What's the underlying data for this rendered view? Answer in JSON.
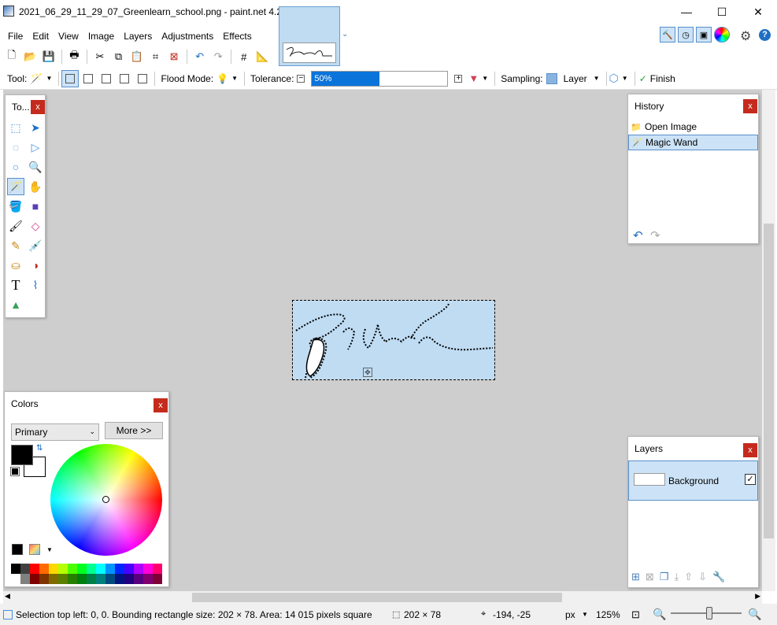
{
  "window": {
    "title": "2021_06_29_11_29_07_Greenlearn_school.png - paint.net 4.2.16",
    "minimize": "—",
    "maximize": "☐",
    "close": "✕"
  },
  "menu": [
    "File",
    "Edit",
    "View",
    "Image",
    "Layers",
    "Adjustments",
    "Effects"
  ],
  "toolbar2": {
    "tool_label": "Tool:",
    "flood_mode_label": "Flood Mode:",
    "tolerance_label": "Tolerance:",
    "tolerance_value": "50%",
    "tolerance_fraction": 0.5,
    "sampling_label": "Sampling:",
    "sampling_value": "Layer",
    "finish_label": "Finish"
  },
  "tools_panel": {
    "title": "To...",
    "close": "x"
  },
  "history_panel": {
    "title": "History",
    "close": "x",
    "items": [
      "Open Image",
      "Magic Wand"
    ],
    "selected_index": 1
  },
  "layers_panel": {
    "title": "Layers",
    "close": "x",
    "layer_name": "Background",
    "layer_visible": "✓"
  },
  "colors_panel": {
    "title": "Colors",
    "close": "x",
    "mode": "Primary",
    "more_button": "More >>",
    "primary_color": "#000000",
    "secondary_color": "#ffffff",
    "palette_top": [
      "#000000",
      "#404040",
      "#ff0000",
      "#ff6a00",
      "#ffd800",
      "#b6ff00",
      "#4cff00",
      "#00ff21",
      "#00ff90",
      "#00ffff",
      "#0094ff",
      "#0026ff",
      "#4800ff",
      "#b200ff",
      "#ff00dc",
      "#ff006e"
    ],
    "palette_bottom": [
      "#ffffff",
      "#808080",
      "#7f0000",
      "#7f3300",
      "#7f6a00",
      "#5b7f00",
      "#267f00",
      "#007f0e",
      "#007f46",
      "#007f7f",
      "#004a7f",
      "#00137f",
      "#21007f",
      "#57007f",
      "#7f006e",
      "#7f0037"
    ]
  },
  "statusbar": {
    "selection_info": "Selection top left: 0, 0. Bounding rectangle size: 202 × 78. Area: 14 015 pixels square",
    "selection_size": "202 × 78",
    "cursor_pos": "-194, -25",
    "units": "px",
    "zoom": "125%"
  },
  "colors": {
    "accent": "#0a74da",
    "selection_bg": "#cce3f7",
    "image_bg": "#bfdcf3",
    "canvas_bg": "#cecece"
  }
}
